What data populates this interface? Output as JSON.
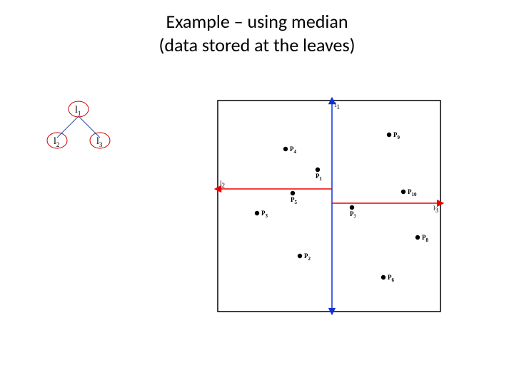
{
  "title": {
    "line1": "Example – using median",
    "line2": "(data stored at the leaves)"
  },
  "tree": {
    "nodes": [
      {
        "id": "n1",
        "l": "l",
        "s": "1"
      },
      {
        "id": "n2",
        "l": "l",
        "s": "2"
      },
      {
        "id": "n3",
        "l": "l",
        "s": "3"
      }
    ]
  },
  "plane": {
    "lines": {
      "l1": {
        "label_l": "l",
        "label_s": "1"
      },
      "l2": {
        "label_l": "l",
        "label_s": "2"
      },
      "l3": {
        "label_l": "l",
        "label_s": "3"
      }
    },
    "points": [
      {
        "name": "P4",
        "l": "P",
        "s": "4",
        "x": 95,
        "y": 68,
        "lx": 6,
        "ly": 3
      },
      {
        "name": "P9",
        "l": "P",
        "s": "9",
        "x": 240,
        "y": 48,
        "lx": 6,
        "ly": 3
      },
      {
        "name": "P1",
        "l": "P",
        "s": "1",
        "x": 140,
        "y": 97,
        "lx": -3,
        "ly": 12
      },
      {
        "name": "P5",
        "l": "P",
        "s": "5",
        "x": 105,
        "y": 130,
        "lx": -3,
        "ly": 12
      },
      {
        "name": "P10",
        "l": "P",
        "s": "10",
        "x": 260,
        "y": 128,
        "lx": 6,
        "ly": 3
      },
      {
        "name": "P3",
        "l": "P",
        "s": "3",
        "x": 55,
        "y": 158,
        "lx": 6,
        "ly": 3
      },
      {
        "name": "P7",
        "l": "P",
        "s": "7",
        "x": 188,
        "y": 150,
        "lx": -3,
        "ly": 12
      },
      {
        "name": "P2",
        "l": "P",
        "s": "2",
        "x": 115,
        "y": 218,
        "lx": 6,
        "ly": 3
      },
      {
        "name": "P8",
        "l": "P",
        "s": "8",
        "x": 280,
        "y": 192,
        "lx": 6,
        "ly": 3
      },
      {
        "name": "P6",
        "l": "P",
        "s": "6",
        "x": 232,
        "y": 248,
        "lx": 6,
        "ly": 3
      }
    ]
  },
  "chart_data": {
    "type": "scatter",
    "title": "2D kd-tree partition (median split, data at leaves)",
    "xlabel": "",
    "ylabel": "",
    "xlim": [
      0,
      312
    ],
    "ylim": [
      0,
      296
    ],
    "series": [
      {
        "name": "points",
        "values": [
          {
            "id": "P1",
            "x": 140,
            "y": 199
          },
          {
            "id": "P2",
            "x": 115,
            "y": 78
          },
          {
            "id": "P3",
            "x": 55,
            "y": 138
          },
          {
            "id": "P4",
            "x": 95,
            "y": 228
          },
          {
            "id": "P5",
            "x": 105,
            "y": 166
          },
          {
            "id": "P6",
            "x": 232,
            "y": 48
          },
          {
            "id": "P7",
            "x": 188,
            "y": 146
          },
          {
            "id": "P8",
            "x": 280,
            "y": 104
          },
          {
            "id": "P9",
            "x": 240,
            "y": 248
          },
          {
            "id": "P10",
            "x": 260,
            "y": 168
          }
        ]
      }
    ],
    "partitions": [
      {
        "id": "l1",
        "axis": "x",
        "at": 160,
        "range": [
          0,
          296
        ]
      },
      {
        "id": "l2",
        "axis": "y",
        "at": 166,
        "range": [
          0,
          160
        ]
      },
      {
        "id": "l3",
        "axis": "y",
        "at": 146,
        "range": [
          160,
          312
        ]
      }
    ],
    "tree": {
      "root": "l1",
      "left": "l2",
      "right": "l3"
    }
  }
}
